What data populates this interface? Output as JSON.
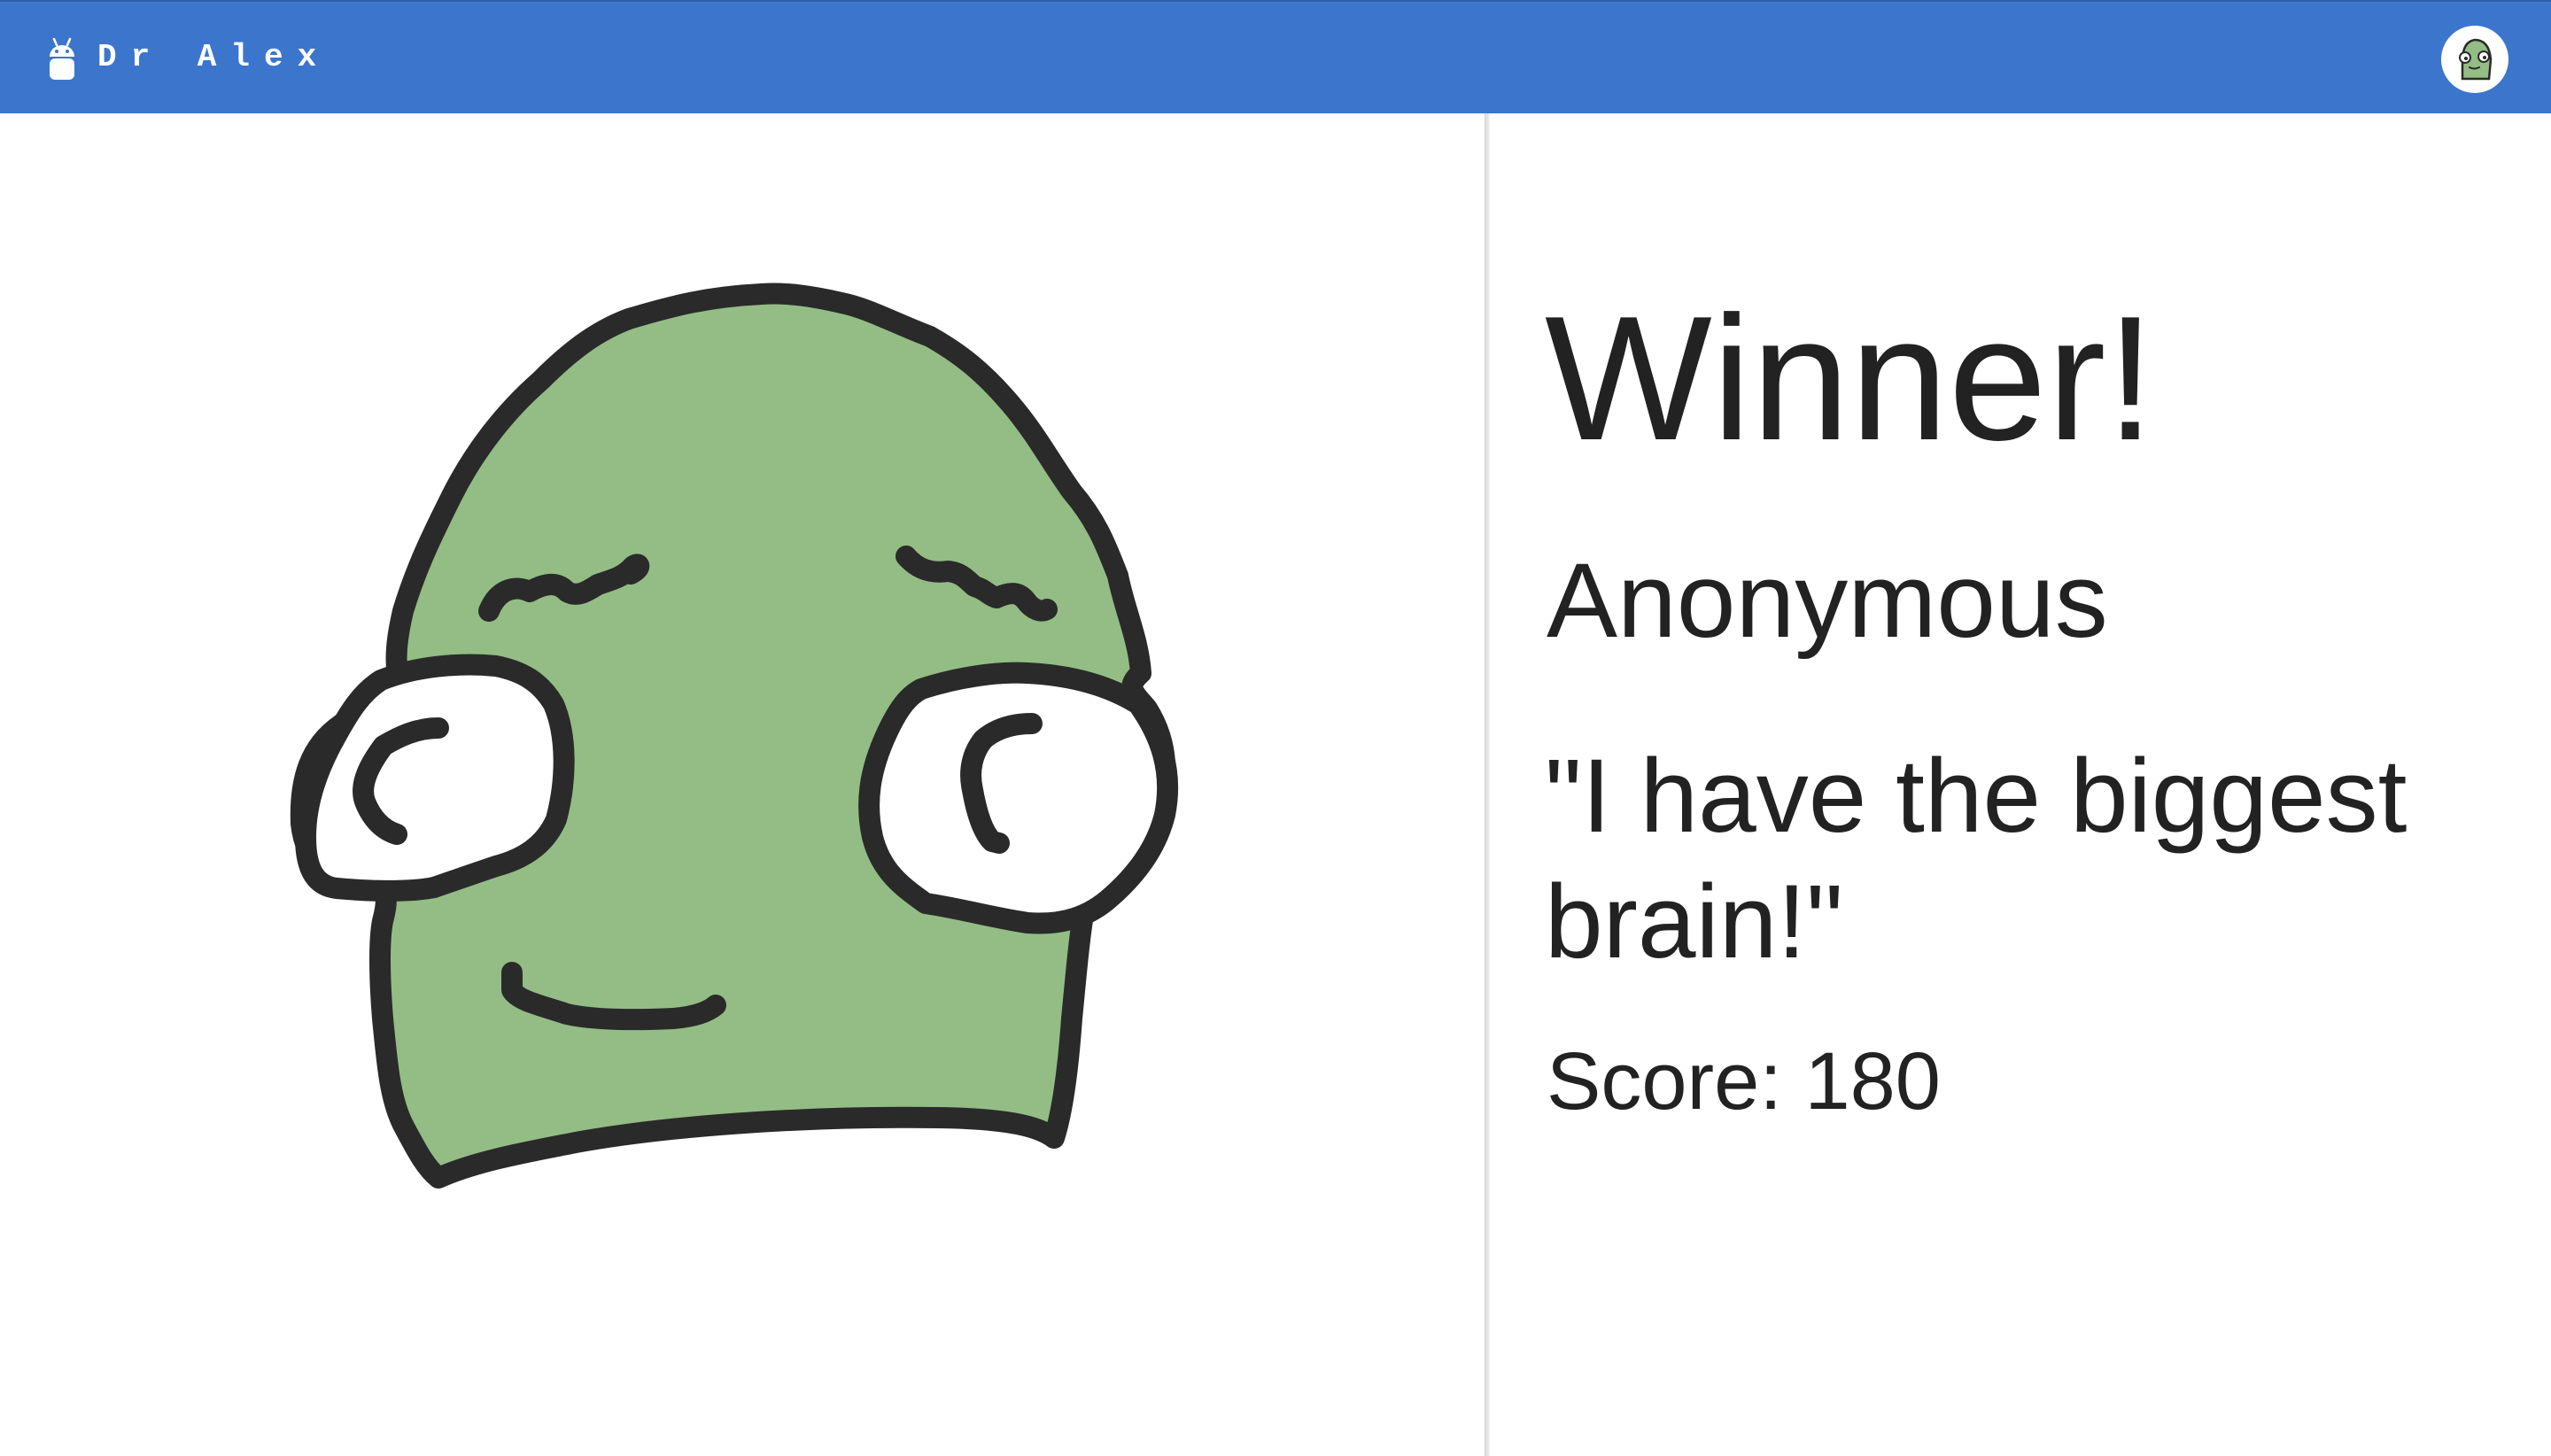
{
  "header": {
    "app_title": "Dr Alex",
    "brand_icon": "android-robot-icon",
    "avatar_icon": "green-character-avatar-icon",
    "bar_color": "#3b76cc"
  },
  "result": {
    "heading": "Winner!",
    "player_name": "Anonymous",
    "quote": "\"I have the biggest brain!\"",
    "score_text": "Score: 180"
  },
  "drawing": {
    "subject": "green-character-drawing",
    "fill_color": "#93bd85",
    "stroke_color": "#2a2a2a"
  }
}
